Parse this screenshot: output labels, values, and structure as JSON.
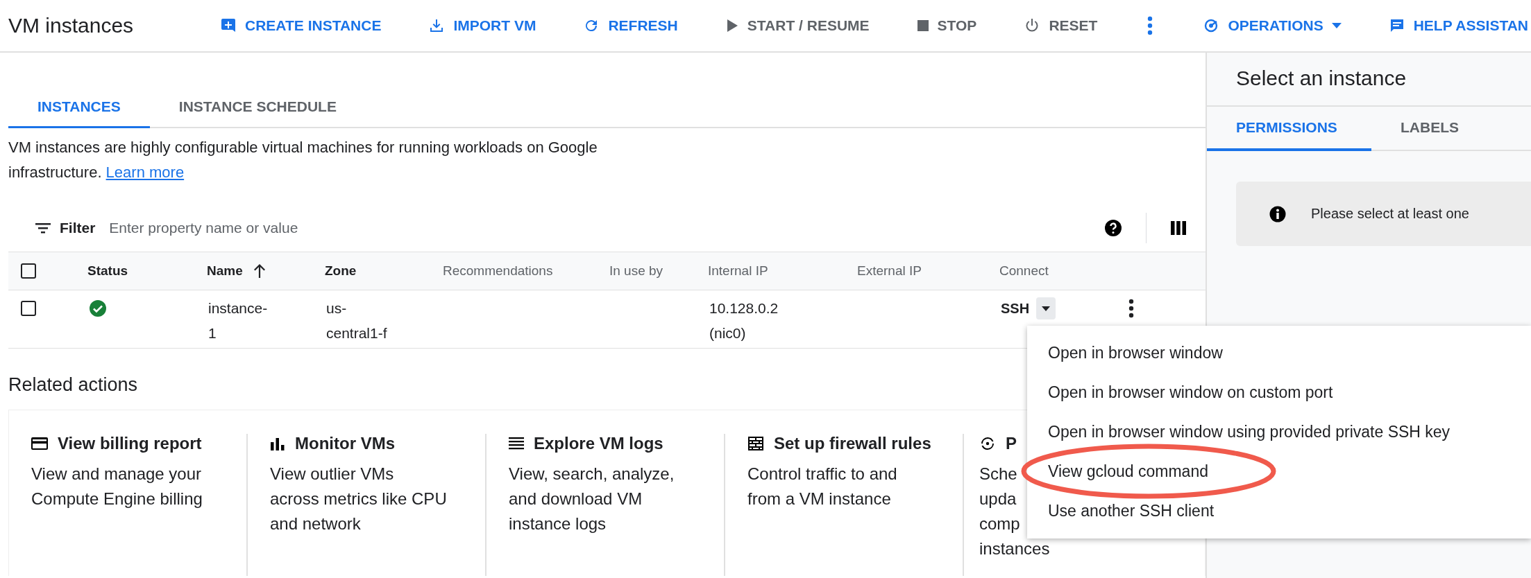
{
  "page": {
    "title": "VM instances"
  },
  "toolbar": [
    {
      "kind": "create",
      "label": "CREATE INSTANCE",
      "disabled": false
    },
    {
      "kind": "import",
      "label": "IMPORT VM",
      "disabled": false
    },
    {
      "kind": "refresh",
      "label": "REFRESH",
      "disabled": false
    },
    {
      "kind": "start",
      "label": "START / RESUME",
      "disabled": true
    },
    {
      "kind": "stop",
      "label": "STOP",
      "disabled": true
    },
    {
      "kind": "reset",
      "label": "RESET",
      "disabled": true
    },
    {
      "kind": "more"
    },
    {
      "kind": "operations",
      "label": "OPERATIONS",
      "disabled": false
    },
    {
      "kind": "help",
      "label": "HELP ASSISTAN",
      "disabled": false
    }
  ],
  "tabs": [
    {
      "label": "INSTANCES",
      "selected": true
    },
    {
      "label": "INSTANCE SCHEDULE",
      "selected": false
    }
  ],
  "description": {
    "text": "VM instances are highly configurable virtual machines for running workloads on Google infrastructure.",
    "link": "Learn more"
  },
  "filter": {
    "label": "Filter",
    "placeholder": "Enter property name or value"
  },
  "table": {
    "header_checked": false,
    "columns": [
      "Status",
      "Name",
      "Zone",
      "Recommendations",
      "In use by",
      "Internal IP",
      "External IP",
      "Connect"
    ],
    "rows": [
      {
        "checked": false,
        "running": true,
        "name": "instance-1",
        "zone": "us-central1-f",
        "internal_ip": "10.128.0.2 (nic0)",
        "connect": "SSH"
      }
    ]
  },
  "related_actions": {
    "title": "Related actions",
    "cards": [
      {
        "title": "View billing report",
        "lines": [
          "View and manage your",
          "Compute Engine billing"
        ]
      },
      {
        "title": "Monitor VMs",
        "lines": [
          "View outlier VMs",
          "across metrics like CPU",
          "and network"
        ]
      },
      {
        "title": "Explore VM logs",
        "lines": [
          "View, search, analyze,",
          "and download VM",
          "instance logs"
        ]
      },
      {
        "title": "Set up firewall rules",
        "lines": [
          "Control traffic to and",
          "from a VM instance"
        ]
      },
      {
        "title": "P",
        "lines": [
          "Sche",
          "upda",
          "comp",
          "instances"
        ]
      }
    ]
  },
  "ssh_menu": {
    "items": [
      {
        "label": "Open in browser window",
        "highlighted": false
      },
      {
        "label": "Open in browser window on custom port",
        "highlighted": false
      },
      {
        "label": "Open in browser window using provided private SSH key",
        "highlighted": false
      },
      {
        "label": "View gcloud command",
        "highlighted": true
      },
      {
        "label": "Use another SSH client",
        "highlighted": false
      }
    ]
  },
  "side_panel": {
    "title": "Select an instance",
    "tabs": [
      {
        "label": "PERMISSIONS",
        "selected": true
      },
      {
        "label": "LABELS",
        "selected": false
      }
    ],
    "info": "Please select at least one"
  }
}
